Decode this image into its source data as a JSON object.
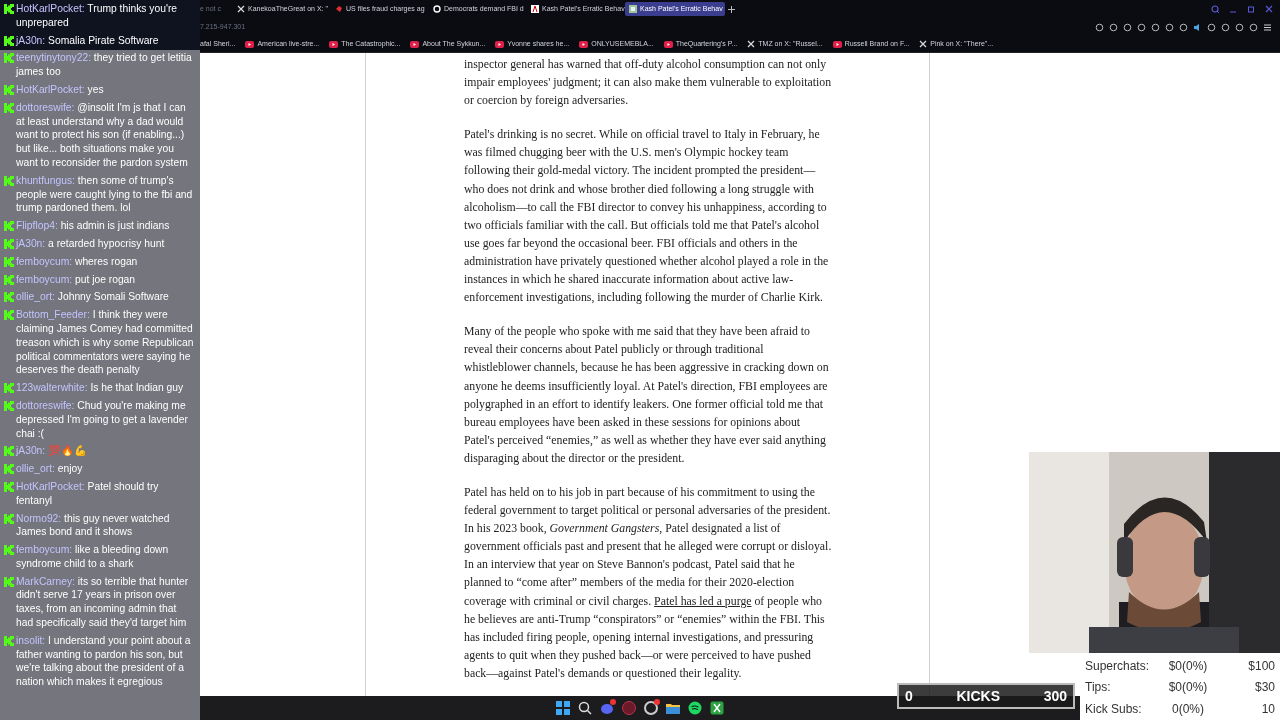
{
  "chat": {
    "messages": [
      {
        "user": "HotKarlPocket:",
        "text": "Trump thinks you're unprepared"
      },
      {
        "user": "jA30n:",
        "text": "Somalia Pirate Software"
      },
      {
        "user": "teenytinytony22:",
        "text": "they tried to get letitia james too"
      },
      {
        "user": "HotKarlPocket:",
        "text": "yes"
      },
      {
        "user": "dottoreswife:",
        "text": "@insolit I'm js that I can at least understand why a dad would want to protect his son (if enabling...) but like... both situations make you want to reconsider the pardon system"
      },
      {
        "user": "khuntfungus:",
        "text": "then some of trump's people were caught lying to the fbi and trump pardoned them. lol"
      },
      {
        "user": "Flipflop4:",
        "text": "his admin is just indians"
      },
      {
        "user": "jA30n:",
        "text": "a retarded hypocrisy hunt"
      },
      {
        "user": "femboycum:",
        "text": "wheres rogan"
      },
      {
        "user": "femboycum:",
        "text": "put joe rogan"
      },
      {
        "user": "ollie_ort:",
        "text": "Johnny Somali Software"
      },
      {
        "user": "Bottom_Feeder:",
        "text": "I think they were claiming James Comey had committed treason which is why some Republican political commentators were saying he deserves the death penalty"
      },
      {
        "user": "123walterwhite:",
        "text": "Is he that Indian guy"
      },
      {
        "user": "dottoreswife:",
        "text": "Chud you're making me depressed I'm going to get a lavender chai :("
      },
      {
        "user": "jA30n:",
        "text": "💯🔥💪"
      },
      {
        "user": "ollie_ort:",
        "text": "enjoy"
      },
      {
        "user": "HotKarlPocket:",
        "text": "Patel should try fentanyl"
      },
      {
        "user": "Normo92:",
        "text": "this guy never watched James bond and it shows"
      },
      {
        "user": "femboycum:",
        "text": "like a bleeding down syndrome child to a shark"
      },
      {
        "user": "MarkCarney:",
        "text": "its so terrible that hunter didn't serve 17 years in prison over taxes, from an incoming admin that had specifically said they'd target him"
      },
      {
        "user": "insolit:",
        "text": "I understand your point about a father wanting to pardon his son, but we're talking about the president of a nation which makes it egregious"
      }
    ]
  },
  "browser": {
    "tabs": [
      {
        "title": "e not c",
        "kind": "none",
        "selected": false
      },
      {
        "title": "KanekoaTheGreat on X: \"",
        "kind": "x",
        "selected": false
      },
      {
        "title": "US files fraud charges ag",
        "kind": "red",
        "selected": false
      },
      {
        "title": "Democrats demand FBI d",
        "kind": "g",
        "selected": false
      },
      {
        "title": "Kash Patel's Erratic Behav",
        "kind": "a",
        "selected": false
      },
      {
        "title": "Kash Patel's Erratic Behav",
        "kind": "archive",
        "selected": true
      }
    ],
    "address": "7.215-947.301",
    "bookmarks": [
      {
        "title": "afal Sheri...",
        "kind": "none"
      },
      {
        "title": "American live-stre...",
        "kind": "yt"
      },
      {
        "title": "The Catastrophic...",
        "kind": "yt"
      },
      {
        "title": "About The Sykkun...",
        "kind": "yt"
      },
      {
        "title": "Yvonne shares he...",
        "kind": "yt"
      },
      {
        "title": "ONLYUSEMEBLA...",
        "kind": "yt"
      },
      {
        "title": "TheQuartering's P...",
        "kind": "yt"
      },
      {
        "title": "TMZ on X: \"Russel...",
        "kind": "x"
      },
      {
        "title": "Russell Brand on F...",
        "kind": "yt"
      },
      {
        "title": "Pink on X: \"There\"...",
        "kind": "x"
      }
    ]
  },
  "article": {
    "paragraphs": [
      [
        {
          "kind": "text",
          "text": "inspector general has warned that off-duty alcohol consumption can not only impair employees' judgment; it can also make them vulnerable to exploitation or coercion by foreign adversaries."
        }
      ],
      [
        {
          "kind": "text",
          "text": "Patel's drinking is no secret. While on official travel to Italy in February, he was filmed chugging beer with the U.S. men's Olympic hockey team following their gold-medal victory. The incident prompted the president—who does not drink and whose brother died following a long struggle with alcoholism—to call the FBI director to convey his unhappiness, according to two officials familiar with the call. But officials told me that Patel's alcohol use goes far beyond the occasional beer. FBI officials and others in the administration have privately questioned whether alcohol played a role in the instances in which he shared inaccurate information about active law-enforcement investigations, including following the murder of Charlie Kirk."
        }
      ],
      [
        {
          "kind": "text",
          "text": "Many of the people who spoke with me said that they have been afraid to reveal their concerns about Patel publicly or through traditional whistleblower channels, because he has been aggressive in cracking down on anyone he deems insufficiently loyal. At Patel's direction, FBI employees are polygraphed in an effort to identify leakers. One former official told me that bureau employees have been asked in these sessions for opinions about Patel's perceived “enemies,” as well as whether they have ever said anything disparaging about the director or the president."
        }
      ],
      [
        {
          "kind": "text",
          "text": "Patel has held on to his job in part because of his commitment to using the federal government to target political or personal adversaries of the president. In his 2023 book, *Government Gangsters*, Patel designated a list of government officials past and present that he alleged were corrupt or disloyal. In an interview that year on Steve Bannon's podcast, Patel said that he planned to “come after” members of the media for their 2020-election coverage with criminal or civil charges."
        },
        {
          "kind": "link",
          "text": "Patel has led a purge"
        },
        {
          "kind": "text",
          "text": "of people who he believes are anti-Trump “conspirators” or “enemies” within the FBI. This has included firing people, opening internal investigations, and pressuring agents to quit when they pushed back—or were perceived to have pushed back—against Patel's demands or questioned their legality."
        }
      ]
    ]
  },
  "kicks_bar": {
    "start": "0",
    "label": "KICKS",
    "end": "300"
  },
  "goals": [
    {
      "label": "Superchats:",
      "current": "$0(0%)",
      "target": "$100"
    },
    {
      "label": "Tips:",
      "current": "$0(0%)",
      "target": "$30"
    },
    {
      "label": "Kick Subs:",
      "current": "0(0%)",
      "target": "10"
    }
  ],
  "taskbar": {
    "apps": [
      {
        "kind": "windows",
        "badge": false
      },
      {
        "kind": "search",
        "badge": false
      },
      {
        "kind": "discord",
        "badge": true
      },
      {
        "kind": "red",
        "badge": false
      },
      {
        "kind": "chrome",
        "badge": true
      },
      {
        "kind": "folder",
        "badge": false
      },
      {
        "kind": "spotify",
        "badge": false
      },
      {
        "kind": "xbox",
        "badge": false
      }
    ]
  }
}
